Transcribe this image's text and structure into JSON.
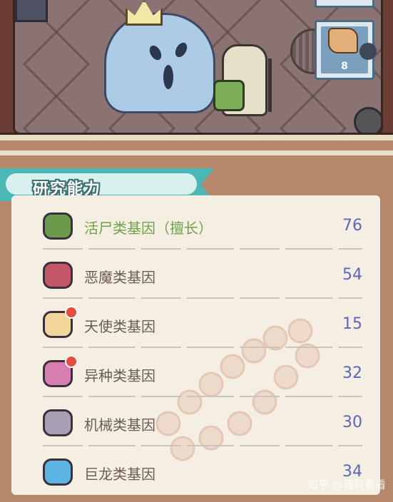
{
  "scene": {
    "card_count": "8"
  },
  "research": {
    "title": "研究能力",
    "items": [
      {
        "label": "活尸类基因（擅长）",
        "value": "76",
        "icon": "zombie-head-icon",
        "color": "#6a9a4a",
        "alert": false,
        "highlight": true
      },
      {
        "label": "恶魔类基因",
        "value": "54",
        "icon": "demon-head-icon",
        "color": "#c4566a",
        "alert": false,
        "highlight": false
      },
      {
        "label": "天使类基因",
        "value": "15",
        "icon": "angel-head-icon",
        "color": "#f2d59a",
        "alert": true,
        "highlight": false
      },
      {
        "label": "异种类基因",
        "value": "32",
        "icon": "alien-eye-icon",
        "color": "#d77fb1",
        "alert": true,
        "highlight": false
      },
      {
        "label": "机械类基因",
        "value": "30",
        "icon": "robot-head-icon",
        "color": "#a99fb5",
        "alert": false,
        "highlight": false
      },
      {
        "label": "巨龙类基因",
        "value": "34",
        "icon": "dragon-head-icon",
        "color": "#5bb4e2",
        "alert": false,
        "highlight": false
      }
    ]
  },
  "watermark": "知乎 @我就看看",
  "colors": {
    "ribbon": "#4bb8b6",
    "value_text": "#5d66b8",
    "highlight_text": "#6fa24a"
  }
}
